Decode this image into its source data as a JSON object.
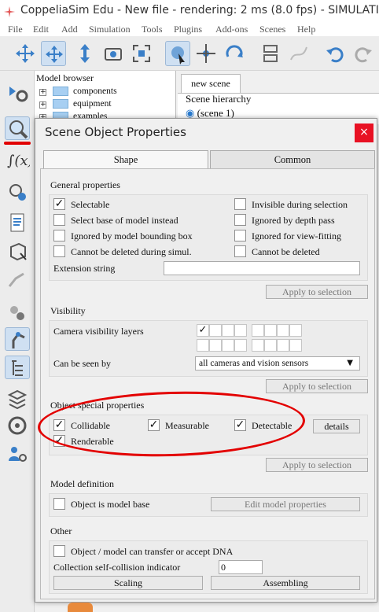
{
  "window": {
    "title": "CoppeliaSim Edu - New file - rendering: 2 ms (8.0 fps) - SIMULATI"
  },
  "menubar": [
    "File",
    "Edit",
    "Add",
    "Simulation",
    "Tools",
    "Plugins",
    "Add-ons",
    "Scenes",
    "Help"
  ],
  "model_browser": {
    "title": "Model browser",
    "items": [
      "components",
      "equipment",
      "examples"
    ]
  },
  "scene": {
    "tab": "new scene",
    "hierarchy_title": "Scene hierarchy",
    "root": "(scene 1)"
  },
  "dialog": {
    "title": "Scene Object Properties",
    "close": "×",
    "tabs": {
      "shape": "Shape",
      "common": "Common"
    },
    "general": {
      "title": "General properties",
      "selectable": "Selectable",
      "invisible_sel": "Invisible during selection",
      "select_base": "Select base of model instead",
      "ignored_depth": "Ignored by depth pass",
      "ignored_bbox": "Ignored by model bounding  box",
      "ignored_fit": "Ignored for view-fitting",
      "no_del_sim": "Cannot be deleted during simul.",
      "no_del": "Cannot be deleted",
      "ext_label": "Extension string",
      "ext_value": "",
      "apply": "Apply to selection"
    },
    "visibility": {
      "title": "Visibility",
      "layers_label": "Camera visibility layers",
      "seen_label": "Can be seen by",
      "seen_value": "all cameras and vision sensors",
      "apply": "Apply to selection"
    },
    "special": {
      "title": "Object special properties",
      "collidable": "Collidable",
      "measurable": "Measurable",
      "detectable": "Detectable",
      "details": "details",
      "renderable": "Renderable",
      "apply": "Apply to selection"
    },
    "model": {
      "title": "Model definition",
      "is_base": "Object is model base",
      "edit": "Edit model properties"
    },
    "other": {
      "title": "Other",
      "dna": "Object / model can transfer or accept DNA",
      "collision_label": "Collection self-collision indicator",
      "collision_value": "0",
      "scaling": "Scaling",
      "assembling": "Assembling"
    }
  },
  "check_mark": "✓"
}
